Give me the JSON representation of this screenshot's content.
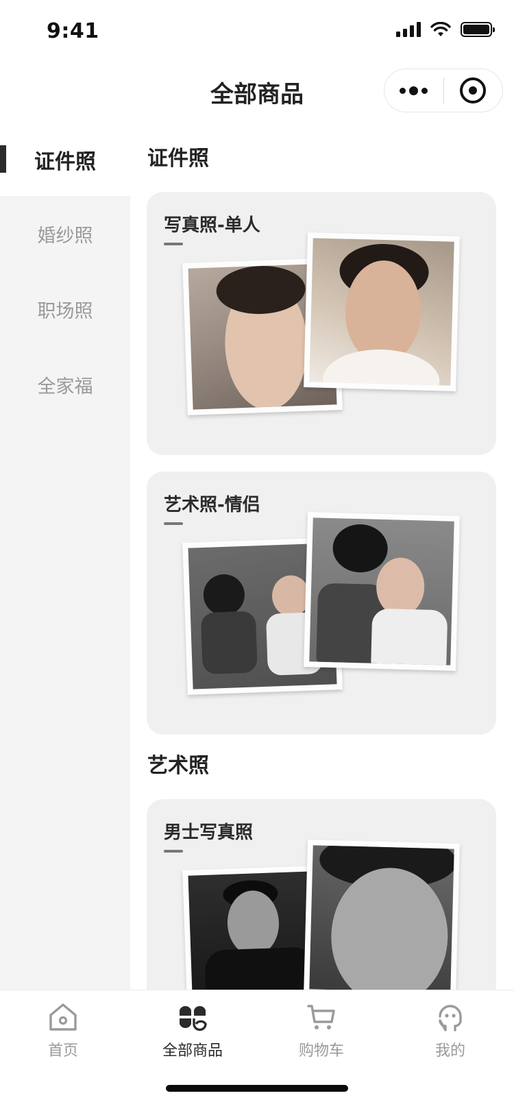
{
  "status_bar": {
    "time": "9:41",
    "battery_level": 1.0
  },
  "header": {
    "title": "全部商品"
  },
  "sidebar": {
    "items": [
      {
        "label": "证件照",
        "active": true
      },
      {
        "label": "婚纱照",
        "active": false
      },
      {
        "label": "职场照",
        "active": false
      },
      {
        "label": "全家福",
        "active": false
      }
    ]
  },
  "sections": [
    {
      "title": "证件照",
      "cards": [
        {
          "title": "写真照-单人"
        },
        {
          "title": "艺术照-情侣"
        }
      ]
    },
    {
      "title": "艺术照",
      "cards": [
        {
          "title": "男士写真照"
        }
      ]
    }
  ],
  "tabbar": {
    "items": [
      {
        "label": "首页",
        "icon": "home-icon",
        "active": false
      },
      {
        "label": "全部商品",
        "icon": "grid-icon",
        "active": true
      },
      {
        "label": "购物车",
        "icon": "cart-icon",
        "active": false
      },
      {
        "label": "我的",
        "icon": "profile-icon",
        "active": false
      }
    ]
  },
  "colors": {
    "accent": "#2b2b2b",
    "inactive": "#9a9a9a",
    "card_bg": "#f0f0f0",
    "sidebar_bg": "#f4f4f4"
  }
}
